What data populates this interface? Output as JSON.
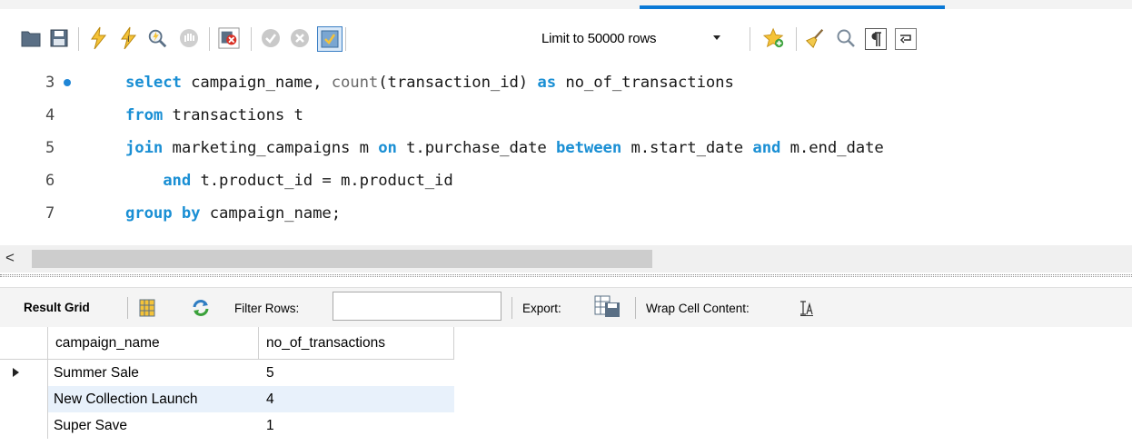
{
  "toolbar": {
    "limit_label": "Limit to 50000 rows",
    "icons": [
      "open-folder-icon",
      "save-icon",
      "execute-icon",
      "execute-current-icon",
      "explain-icon",
      "stop-icon",
      "toggle-error-icon",
      "commit-icon",
      "rollback-icon",
      "autocommit-icon",
      "add-snippet-icon",
      "beautify-icon",
      "find-icon",
      "invisible-chars-icon",
      "wrap-lines-icon"
    ]
  },
  "editor": {
    "lines": [
      {
        "num": "3",
        "parts": [
          {
            "t": "select",
            "k": "kw"
          },
          {
            "t": " campaign_name, ",
            "k": ""
          },
          {
            "t": "count",
            "k": "fn"
          },
          {
            "t": "(transaction_id) ",
            "k": ""
          },
          {
            "t": "as",
            "k": "kw"
          },
          {
            "t": " no_of_transactions",
            "k": ""
          }
        ]
      },
      {
        "num": "4",
        "parts": [
          {
            "t": "from",
            "k": "kw"
          },
          {
            "t": " transactions t",
            "k": ""
          }
        ]
      },
      {
        "num": "5",
        "parts": [
          {
            "t": "join",
            "k": "kw"
          },
          {
            "t": " marketing_campaigns m ",
            "k": ""
          },
          {
            "t": "on",
            "k": "kw"
          },
          {
            "t": " t.purchase_date ",
            "k": ""
          },
          {
            "t": "between",
            "k": "kw"
          },
          {
            "t": " m.start_date ",
            "k": ""
          },
          {
            "t": "and",
            "k": "kw"
          },
          {
            "t": " m.end_date",
            "k": ""
          }
        ]
      },
      {
        "num": "6",
        "parts": [
          {
            "t": "    ",
            "k": ""
          },
          {
            "t": "and",
            "k": "kw"
          },
          {
            "t": " t.product_id = m.product_id",
            "k": ""
          }
        ]
      },
      {
        "num": "7",
        "parts": [
          {
            "t": "group by",
            "k": "kw"
          },
          {
            "t": " campaign_name;",
            "k": ""
          }
        ]
      }
    ]
  },
  "scrollbar": {
    "left_arrow": "<"
  },
  "result_bar": {
    "result_grid_label": "Result Grid",
    "filter_label": "Filter Rows:",
    "filter_value": "",
    "export_label": "Export:",
    "wrap_label": "Wrap Cell Content:"
  },
  "grid": {
    "columns": [
      "campaign_name",
      "no_of_transactions"
    ],
    "rows": [
      [
        "Summer Sale",
        "5"
      ],
      [
        "New Collection Launch",
        "4"
      ],
      [
        "Super Save",
        "1"
      ]
    ]
  },
  "colors": {
    "keyword": "#1a8fd4",
    "selected_row": "#e8f1fb",
    "accent": "#0a79d6"
  }
}
